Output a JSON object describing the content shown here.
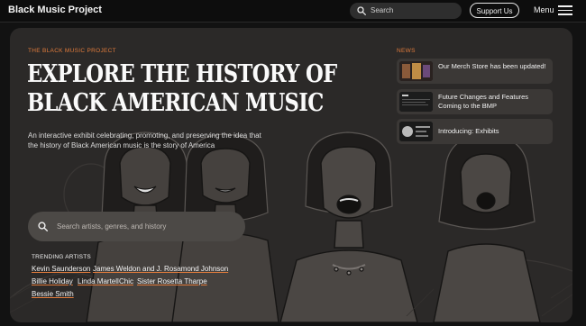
{
  "header": {
    "brand": "Black Music Project",
    "search_placeholder": "Search",
    "support_label": "Support Us",
    "menu_label": "Menu"
  },
  "hero": {
    "eyebrow": "THE BLACK MUSIC PROJECT",
    "headline_line1": "EXPLORE THE HISTORY OF",
    "headline_line2": "BLACK AMERICAN MUSIC",
    "subtitle": "An interactive exhibit celebrating, promoting, and preserving the idea that the history of Black American music is the story of America",
    "search_placeholder": "Search artists, genres, and history",
    "trending_label": "TRENDING ARTISTS",
    "trending": [
      "Kevin Saunderson",
      "James Weldon and J. Rosamond Johnson",
      "Billie Holiday",
      "Linda Martell",
      "Chic",
      "Sister Rosetta Tharpe",
      "Bessie Smith"
    ]
  },
  "news": {
    "label": "NEWS",
    "items": [
      {
        "title": "Our Merch Store has been updated!"
      },
      {
        "title": "Future Changes and Features Coming to the BMP"
      },
      {
        "title": "Introducing: Exhibits"
      }
    ]
  },
  "colors": {
    "accent": "#e07b3c",
    "background": "#121212",
    "hero_background": "#2b2928",
    "card": "#3b3836",
    "search_field": "#4c4946"
  }
}
